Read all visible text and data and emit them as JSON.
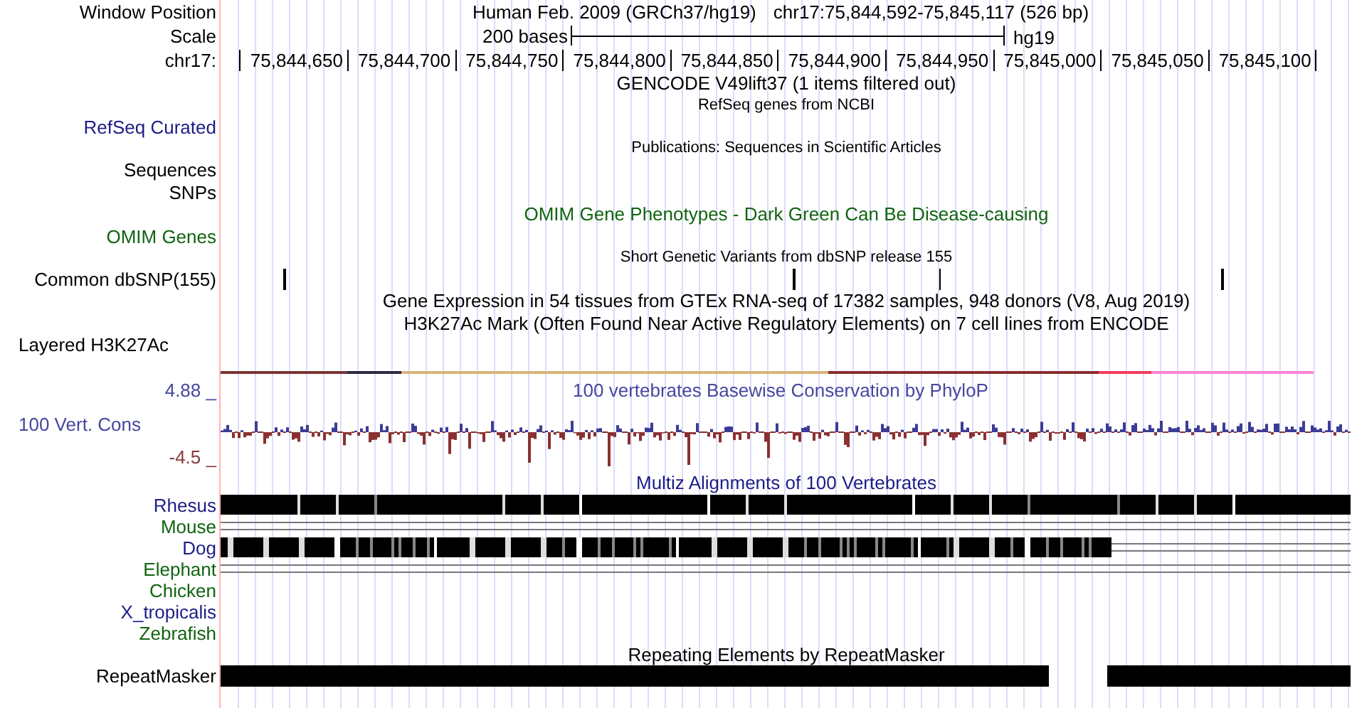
{
  "header": {
    "position_label": "Window Position",
    "assembly": "Human Feb. 2009 (GRCh37/hg19)",
    "position": "chr17:75,844,592-75,845,117 (526 bp)",
    "scale_label": "Scale",
    "scale_text": "200 bases",
    "database": "hg19",
    "chrom_label": "chr17:",
    "ticks": [
      "75,844,650",
      "75,844,700",
      "75,844,750",
      "75,844,800",
      "75,844,850",
      "75,844,900",
      "75,844,950",
      "75,845,000",
      "75,845,050",
      "75,845,100"
    ]
  },
  "rows": [
    {
      "kind": "title",
      "title": "GENCODE V49lift37 (1 items filtered out)",
      "color": "#000000"
    },
    {
      "kind": "note",
      "title": "RefSeq genes from NCBI"
    },
    {
      "kind": "label",
      "label": "RefSeq Curated",
      "color": "#1c1c86"
    },
    {
      "kind": "note",
      "title": "Publications: Sequences in Scientific Articles"
    },
    {
      "kind": "label",
      "label": "Sequences",
      "color": "#000000"
    },
    {
      "kind": "label",
      "label": "SNPs",
      "color": "#000000"
    },
    {
      "kind": "title",
      "title": "OMIM Gene Phenotypes - Dark Green Can Be Disease-causing",
      "color": "#106410"
    },
    {
      "kind": "label",
      "label": "OMIM Genes",
      "color": "#106410"
    },
    {
      "kind": "note",
      "title": "Short Genetic Variants from dbSNP release 155"
    },
    {
      "kind": "snp",
      "label": "Common dbSNP(155)",
      "color": "#000000"
    },
    {
      "kind": "title",
      "title": "Gene Expression in 54 tissues from GTEx RNA-seq of 17382 samples, 948 donors (V8, Aug 2019)",
      "color": "#000000"
    },
    {
      "kind": "title",
      "title": "H3K27Ac Mark (Often Found Near Active Regulatory Elements) on 7 cell lines from ENCODE",
      "color": "#000000"
    },
    {
      "kind": "layered",
      "label": "Layered H3K27Ac",
      "color": "#000000"
    },
    {
      "kind": "signal",
      "max": "4.88 _",
      "label": "100 Vert. Cons",
      "min": "-4.5 _",
      "title": "100 vertebrates Basewise Conservation by PhyloP"
    },
    {
      "kind": "title",
      "title": "Multiz Alignments of 100 Vertebrates",
      "color": "#1c1c86"
    },
    {
      "kind": "full",
      "label": "Rhesus",
      "color": "#1c1c86"
    },
    {
      "kind": "lines",
      "label": "Mouse",
      "color": "#106410"
    },
    {
      "kind": "partial",
      "label": "Dog",
      "color": "#1c1c86"
    },
    {
      "kind": "lines",
      "label": "Elephant",
      "color": "#106410"
    },
    {
      "kind": "empty",
      "label": "Chicken",
      "color": "#106410"
    },
    {
      "kind": "empty",
      "label": "X_tropicalis",
      "color": "#1c1c86"
    },
    {
      "kind": "empty",
      "label": "Zebrafish",
      "color": "#106410"
    },
    {
      "kind": "title",
      "title": "Repeating Elements by RepeatMasker",
      "color": "#000000"
    },
    {
      "kind": "repeat",
      "label": "RepeatMasker",
      "color": "#000000"
    }
  ]
}
